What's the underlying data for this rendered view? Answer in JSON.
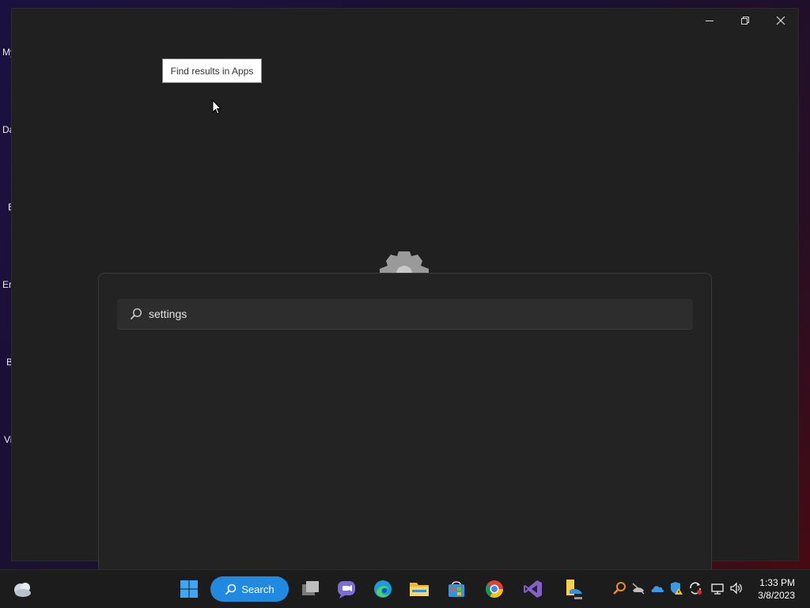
{
  "desktop": {
    "labels": [
      "My",
      "Da",
      "E",
      "Er",
      "B",
      "Vi"
    ]
  },
  "window": {
    "tooltip": "Find results in Apps"
  },
  "search": {
    "value": "settings",
    "placeholder": ""
  },
  "taskbar": {
    "search_label": "Search",
    "apps": [
      "weather-icon",
      "task-view-icon",
      "teams-chat-icon",
      "edge-icon",
      "file-explorer-icon",
      "store-icon",
      "chrome-icon",
      "visual-studio-icon",
      "notes-icon"
    ],
    "tray": [
      "search-tool-icon",
      "no-network-icon",
      "onedrive-icon",
      "security-warning-icon",
      "sync-icon",
      "display-icon",
      "volume-icon"
    ],
    "time": "1:33 PM",
    "date": "3/8/2023"
  },
  "colors": {
    "accent": "#1f8ae0",
    "window_bg": "#202020",
    "panel_bg": "#232323"
  }
}
